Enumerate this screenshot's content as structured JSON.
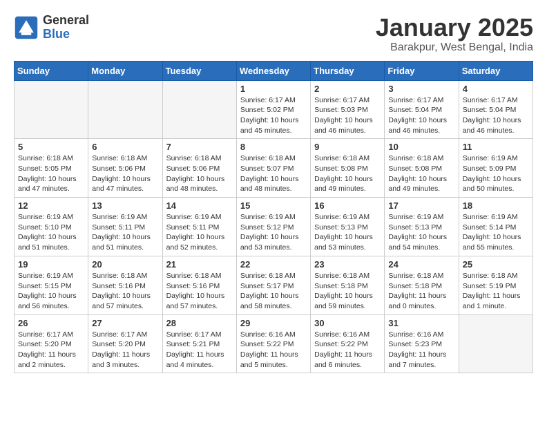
{
  "header": {
    "logo_general": "General",
    "logo_blue": "Blue",
    "title": "January 2025",
    "subtitle": "Barakpur, West Bengal, India"
  },
  "weekdays": [
    "Sunday",
    "Monday",
    "Tuesday",
    "Wednesday",
    "Thursday",
    "Friday",
    "Saturday"
  ],
  "weeks": [
    [
      {
        "day": "",
        "empty": true
      },
      {
        "day": "",
        "empty": true
      },
      {
        "day": "",
        "empty": true
      },
      {
        "day": "1",
        "sunrise": "6:17 AM",
        "sunset": "5:02 PM",
        "daylight": "10 hours and 45 minutes."
      },
      {
        "day": "2",
        "sunrise": "6:17 AM",
        "sunset": "5:03 PM",
        "daylight": "10 hours and 46 minutes."
      },
      {
        "day": "3",
        "sunrise": "6:17 AM",
        "sunset": "5:04 PM",
        "daylight": "10 hours and 46 minutes."
      },
      {
        "day": "4",
        "sunrise": "6:17 AM",
        "sunset": "5:04 PM",
        "daylight": "10 hours and 46 minutes."
      }
    ],
    [
      {
        "day": "5",
        "sunrise": "6:18 AM",
        "sunset": "5:05 PM",
        "daylight": "10 hours and 47 minutes."
      },
      {
        "day": "6",
        "sunrise": "6:18 AM",
        "sunset": "5:06 PM",
        "daylight": "10 hours and 47 minutes."
      },
      {
        "day": "7",
        "sunrise": "6:18 AM",
        "sunset": "5:06 PM",
        "daylight": "10 hours and 48 minutes."
      },
      {
        "day": "8",
        "sunrise": "6:18 AM",
        "sunset": "5:07 PM",
        "daylight": "10 hours and 48 minutes."
      },
      {
        "day": "9",
        "sunrise": "6:18 AM",
        "sunset": "5:08 PM",
        "daylight": "10 hours and 49 minutes."
      },
      {
        "day": "10",
        "sunrise": "6:18 AM",
        "sunset": "5:08 PM",
        "daylight": "10 hours and 49 minutes."
      },
      {
        "day": "11",
        "sunrise": "6:19 AM",
        "sunset": "5:09 PM",
        "daylight": "10 hours and 50 minutes."
      }
    ],
    [
      {
        "day": "12",
        "sunrise": "6:19 AM",
        "sunset": "5:10 PM",
        "daylight": "10 hours and 51 minutes."
      },
      {
        "day": "13",
        "sunrise": "6:19 AM",
        "sunset": "5:11 PM",
        "daylight": "10 hours and 51 minutes."
      },
      {
        "day": "14",
        "sunrise": "6:19 AM",
        "sunset": "5:11 PM",
        "daylight": "10 hours and 52 minutes."
      },
      {
        "day": "15",
        "sunrise": "6:19 AM",
        "sunset": "5:12 PM",
        "daylight": "10 hours and 53 minutes."
      },
      {
        "day": "16",
        "sunrise": "6:19 AM",
        "sunset": "5:13 PM",
        "daylight": "10 hours and 53 minutes."
      },
      {
        "day": "17",
        "sunrise": "6:19 AM",
        "sunset": "5:13 PM",
        "daylight": "10 hours and 54 minutes."
      },
      {
        "day": "18",
        "sunrise": "6:19 AM",
        "sunset": "5:14 PM",
        "daylight": "10 hours and 55 minutes."
      }
    ],
    [
      {
        "day": "19",
        "sunrise": "6:19 AM",
        "sunset": "5:15 PM",
        "daylight": "10 hours and 56 minutes."
      },
      {
        "day": "20",
        "sunrise": "6:18 AM",
        "sunset": "5:16 PM",
        "daylight": "10 hours and 57 minutes."
      },
      {
        "day": "21",
        "sunrise": "6:18 AM",
        "sunset": "5:16 PM",
        "daylight": "10 hours and 57 minutes."
      },
      {
        "day": "22",
        "sunrise": "6:18 AM",
        "sunset": "5:17 PM",
        "daylight": "10 hours and 58 minutes."
      },
      {
        "day": "23",
        "sunrise": "6:18 AM",
        "sunset": "5:18 PM",
        "daylight": "10 hours and 59 minutes."
      },
      {
        "day": "24",
        "sunrise": "6:18 AM",
        "sunset": "5:18 PM",
        "daylight": "11 hours and 0 minutes."
      },
      {
        "day": "25",
        "sunrise": "6:18 AM",
        "sunset": "5:19 PM",
        "daylight": "11 hours and 1 minute."
      }
    ],
    [
      {
        "day": "26",
        "sunrise": "6:17 AM",
        "sunset": "5:20 PM",
        "daylight": "11 hours and 2 minutes."
      },
      {
        "day": "27",
        "sunrise": "6:17 AM",
        "sunset": "5:20 PM",
        "daylight": "11 hours and 3 minutes."
      },
      {
        "day": "28",
        "sunrise": "6:17 AM",
        "sunset": "5:21 PM",
        "daylight": "11 hours and 4 minutes."
      },
      {
        "day": "29",
        "sunrise": "6:16 AM",
        "sunset": "5:22 PM",
        "daylight": "11 hours and 5 minutes."
      },
      {
        "day": "30",
        "sunrise": "6:16 AM",
        "sunset": "5:22 PM",
        "daylight": "11 hours and 6 minutes."
      },
      {
        "day": "31",
        "sunrise": "6:16 AM",
        "sunset": "5:23 PM",
        "daylight": "11 hours and 7 minutes."
      },
      {
        "day": "",
        "empty": true
      }
    ]
  ],
  "labels": {
    "sunrise_label": "Sunrise:",
    "sunset_label": "Sunset:",
    "daylight_label": "Daylight:"
  }
}
